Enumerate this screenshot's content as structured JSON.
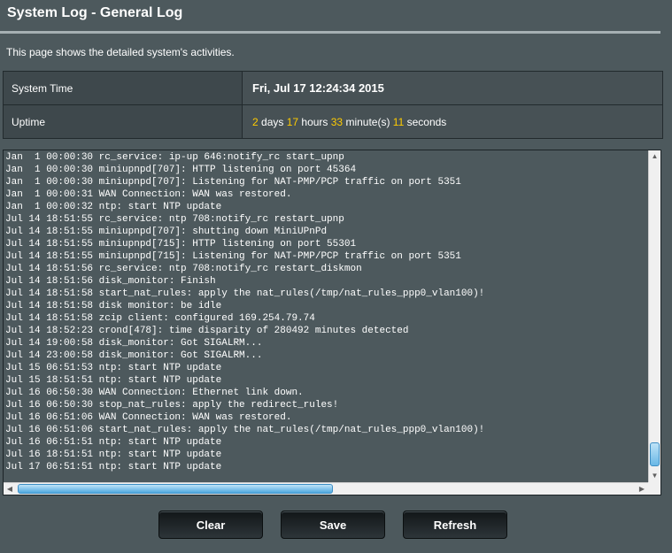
{
  "header": {
    "title": "System Log - General Log",
    "description": "This page shows the detailed system's activities."
  },
  "info": {
    "system_time_label": "System Time",
    "system_time_value": "Fri, Jul 17 12:24:34 2015",
    "uptime_label": "Uptime",
    "uptime": {
      "days": "2",
      "days_label": " days ",
      "hours": "17",
      "hours_label": " hours ",
      "minutes": "33",
      "minutes_label": " minute(s) ",
      "seconds": "11",
      "seconds_label": " seconds"
    }
  },
  "log": {
    "lines": [
      "Jan  1 00:00:30 rc_service: ip-up 646:notify_rc start_upnp",
      "Jan  1 00:00:30 miniupnpd[707]: HTTP listening on port 45364",
      "Jan  1 00:00:30 miniupnpd[707]: Listening for NAT-PMP/PCP traffic on port 5351",
      "Jan  1 00:00:31 WAN Connection: WAN was restored.",
      "Jan  1 00:00:32 ntp: start NTP update",
      "Jul 14 18:51:55 rc_service: ntp 708:notify_rc restart_upnp",
      "Jul 14 18:51:55 miniupnpd[707]: shutting down MiniUPnPd",
      "Jul 14 18:51:55 miniupnpd[715]: HTTP listening on port 55301",
      "Jul 14 18:51:55 miniupnpd[715]: Listening for NAT-PMP/PCP traffic on port 5351",
      "Jul 14 18:51:56 rc_service: ntp 708:notify_rc restart_diskmon",
      "Jul 14 18:51:56 disk_monitor: Finish",
      "Jul 14 18:51:58 start_nat_rules: apply the nat_rules(/tmp/nat_rules_ppp0_vlan100)!",
      "Jul 14 18:51:58 disk monitor: be idle",
      "Jul 14 18:51:58 zcip client: configured 169.254.79.74",
      "Jul 14 18:52:23 crond[478]: time disparity of 280492 minutes detected",
      "Jul 14 19:00:58 disk_monitor: Got SIGALRM...",
      "Jul 14 23:00:58 disk_monitor: Got SIGALRM...",
      "Jul 15 06:51:53 ntp: start NTP update",
      "Jul 15 18:51:51 ntp: start NTP update",
      "Jul 16 06:50:30 WAN Connection: Ethernet link down.",
      "Jul 16 06:50:30 stop_nat_rules: apply the redirect_rules!",
      "Jul 16 06:51:06 WAN Connection: WAN was restored.",
      "Jul 16 06:51:06 start_nat_rules: apply the nat_rules(/tmp/nat_rules_ppp0_vlan100)!",
      "Jul 16 06:51:51 ntp: start NTP update",
      "Jul 16 18:51:51 ntp: start NTP update",
      "Jul 17 06:51:51 ntp: start NTP update"
    ],
    "scrollbar_icons": {
      "up": "arrow-up-icon",
      "down": "arrow-down-icon",
      "left": "arrow-left-icon",
      "right": "arrow-right-icon"
    }
  },
  "buttons": {
    "clear": "Clear",
    "save": "Save",
    "refresh": "Refresh"
  },
  "colors": {
    "background": "#4d595d",
    "highlight_number": "#ffcc00"
  }
}
